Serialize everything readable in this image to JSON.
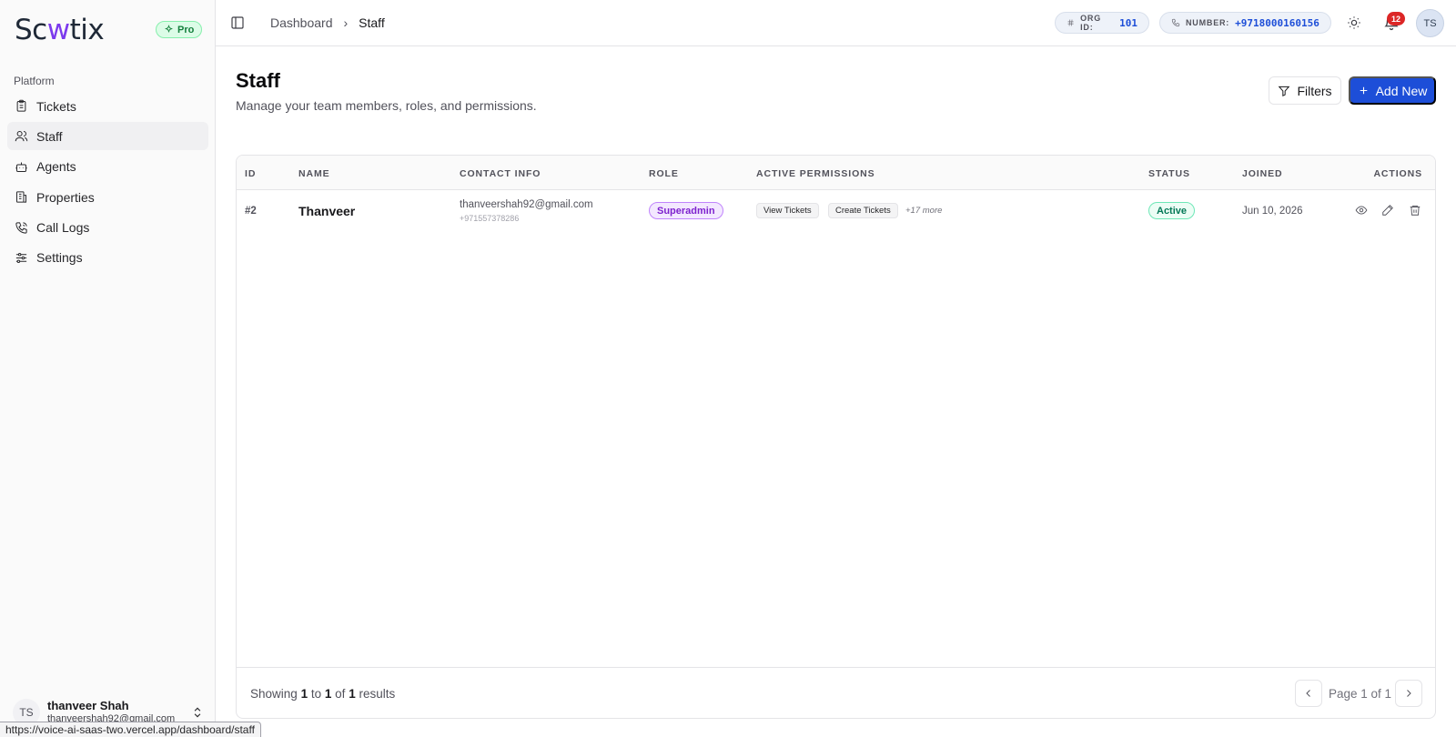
{
  "brand": {
    "prefix": "Sc",
    "highlight": "w",
    "suffix": "tix",
    "badge": "Pro"
  },
  "sidebar": {
    "section_label": "Platform",
    "items": [
      {
        "label": "Tickets",
        "icon": "clipboard-icon",
        "active": false
      },
      {
        "label": "Staff",
        "icon": "users-icon",
        "active": true
      },
      {
        "label": "Agents",
        "icon": "bot-icon",
        "active": false
      },
      {
        "label": "Properties",
        "icon": "building-icon",
        "active": false
      },
      {
        "label": "Call Logs",
        "icon": "phone-icon",
        "active": false
      },
      {
        "label": "Settings",
        "icon": "sliders-icon",
        "active": false
      }
    ],
    "user": {
      "initials": "TS",
      "name": "thanveer Shah",
      "email": "thanveershah92@gmail.com"
    }
  },
  "status_url": "https://voice-ai-saas-two.vercel.app/dashboard/staff",
  "header": {
    "breadcrumb": {
      "parent": "Dashboard",
      "separator": "›",
      "current": "Staff"
    },
    "org": {
      "label": "ORG ID:",
      "value": "101"
    },
    "number": {
      "label": "NUMBER:",
      "value": "+9718000160156"
    },
    "notification_count": "12",
    "avatar_initials": "TS"
  },
  "page": {
    "title": "Staff",
    "subtitle": "Manage your team members, roles, and permissions.",
    "filters_label": "Filters",
    "add_label": "Add New"
  },
  "table": {
    "columns": {
      "id": "ID",
      "name": "NAME",
      "contact": "CONTACT INFO",
      "role": "ROLE",
      "permissions": "ACTIVE PERMISSIONS",
      "status": "STATUS",
      "joined": "JOINED",
      "actions": "ACTIONS"
    },
    "rows": [
      {
        "id": "#2",
        "name": "Thanveer",
        "email": "thanveershah92@gmail.com",
        "phone": "+971557378286",
        "role": "Superadmin",
        "permissions": [
          "View Tickets",
          "Create Tickets"
        ],
        "more": "+17 more",
        "status": "Active",
        "joined": "Jun 10, 2026"
      }
    ],
    "footer": {
      "showing_prefix": "Showing",
      "from": "1",
      "to_word": "to",
      "to": "1",
      "of_word": "of",
      "total": "1",
      "results_word": "results",
      "page_label": "Page 1 of 1"
    }
  },
  "colors": {
    "primary": "#1d4ed8",
    "role_badge": "#7e22ce",
    "status_active": "#047857",
    "notification": "#dc2626"
  }
}
